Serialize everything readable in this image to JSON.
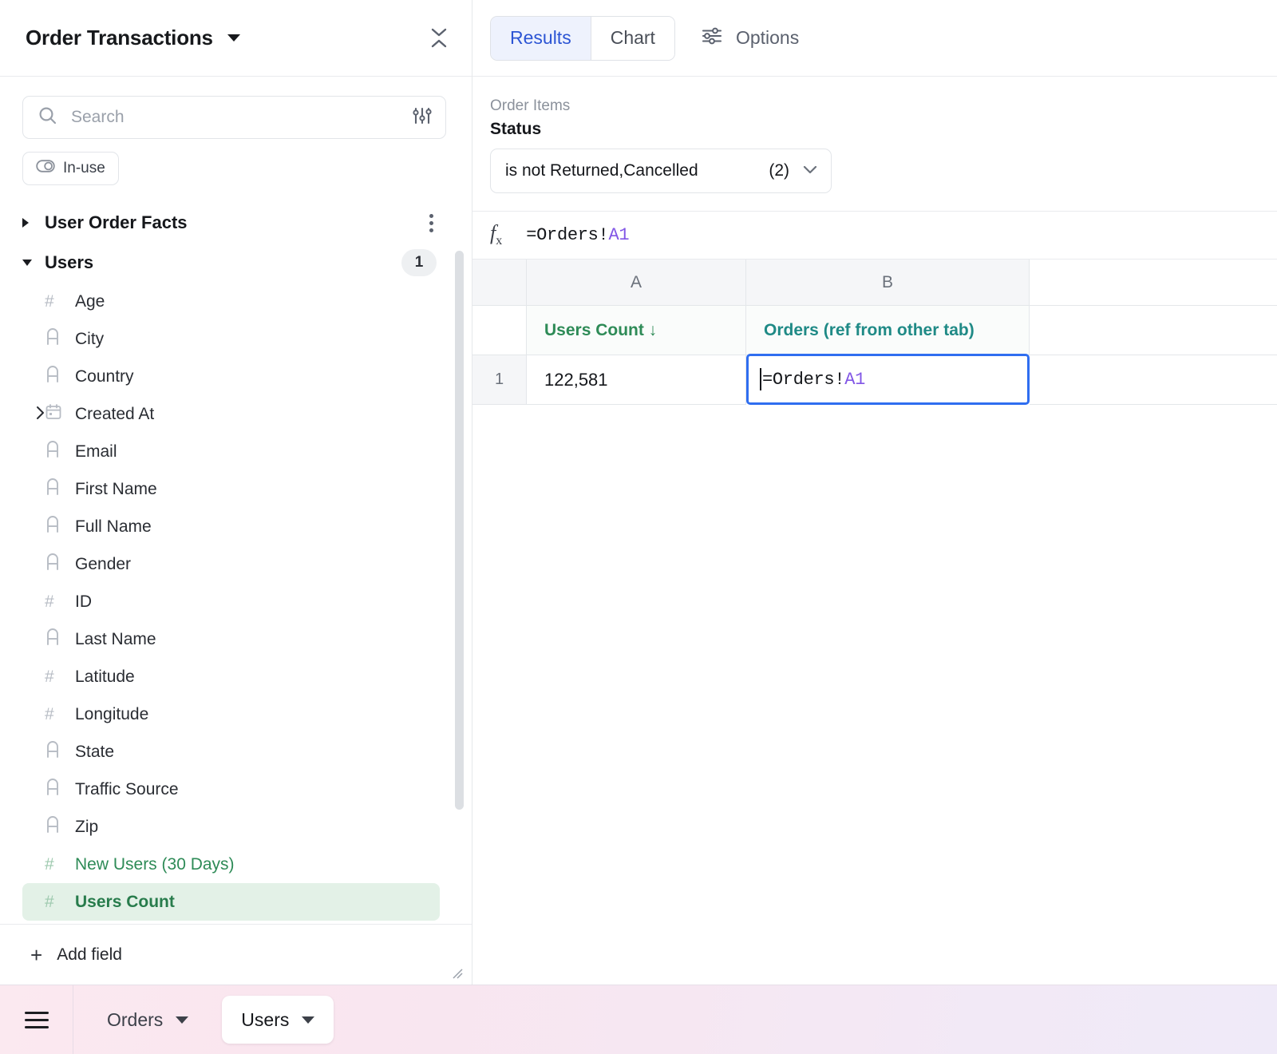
{
  "sidebar": {
    "title": "Order Transactions",
    "title_caret_icon": "caret-down-icon",
    "collapse_icon": "collapse-vertical-icon",
    "search": {
      "placeholder": "Search",
      "value": "",
      "icon": "search-icon",
      "filter_icon": "sliders-icon"
    },
    "chip": {
      "label": "In-use",
      "icon": "toggle-icon"
    },
    "groups": [
      {
        "name": "User Order Facts",
        "expanded": false,
        "menu_icon": "kebab-menu-icon"
      },
      {
        "name": "Users",
        "expanded": true,
        "badge": "1"
      }
    ],
    "fields": [
      {
        "label": "Age",
        "icon": "hash-icon",
        "type": "number",
        "expandable": false,
        "selected": false,
        "measure": false
      },
      {
        "label": "City",
        "icon": "text-icon",
        "type": "text",
        "expandable": false,
        "selected": false,
        "measure": false
      },
      {
        "label": "Country",
        "icon": "text-icon",
        "type": "text",
        "expandable": false,
        "selected": false,
        "measure": false
      },
      {
        "label": "Created At",
        "icon": "calendar-icon",
        "type": "date",
        "expandable": true,
        "selected": false,
        "measure": false
      },
      {
        "label": "Email",
        "icon": "text-icon",
        "type": "text",
        "expandable": false,
        "selected": false,
        "measure": false
      },
      {
        "label": "First Name",
        "icon": "text-icon",
        "type": "text",
        "expandable": false,
        "selected": false,
        "measure": false
      },
      {
        "label": "Full Name",
        "icon": "text-icon",
        "type": "text",
        "expandable": false,
        "selected": false,
        "measure": false
      },
      {
        "label": "Gender",
        "icon": "text-icon",
        "type": "text",
        "expandable": false,
        "selected": false,
        "measure": false
      },
      {
        "label": "ID",
        "icon": "hash-icon",
        "type": "number",
        "expandable": false,
        "selected": false,
        "measure": false
      },
      {
        "label": "Last Name",
        "icon": "text-icon",
        "type": "text",
        "expandable": false,
        "selected": false,
        "measure": false
      },
      {
        "label": "Latitude",
        "icon": "hash-icon",
        "type": "number",
        "expandable": false,
        "selected": false,
        "measure": false
      },
      {
        "label": "Longitude",
        "icon": "hash-icon",
        "type": "number",
        "expandable": false,
        "selected": false,
        "measure": false
      },
      {
        "label": "State",
        "icon": "text-icon",
        "type": "text",
        "expandable": false,
        "selected": false,
        "measure": false
      },
      {
        "label": "Traffic Source",
        "icon": "text-icon",
        "type": "text",
        "expandable": false,
        "selected": false,
        "measure": false
      },
      {
        "label": "Zip",
        "icon": "text-icon",
        "type": "text",
        "expandable": false,
        "selected": false,
        "measure": false
      },
      {
        "label": "New Users (30 Days)",
        "icon": "hash-icon",
        "type": "number",
        "expandable": false,
        "selected": false,
        "measure": true
      },
      {
        "label": "Users Count",
        "icon": "hash-icon",
        "type": "number",
        "expandable": false,
        "selected": true,
        "measure": true
      }
    ],
    "footer": {
      "add_field_label": "Add field",
      "add_icon": "plus-icon",
      "resize_icon": "resize-grip-icon"
    }
  },
  "main": {
    "tabs": [
      {
        "label": "Results",
        "active": true
      },
      {
        "label": "Chart",
        "active": false
      }
    ],
    "options": {
      "label": "Options",
      "icon": "sliders-horizontal-icon"
    },
    "filter": {
      "source": "Order Items",
      "field": "Status",
      "value": "is not Returned,Cancelled",
      "count": "(2)",
      "chevron_icon": "chevron-down-icon"
    },
    "formula_bar": {
      "icon": "fx-icon",
      "prefix": "=Orders!",
      "ref": "A1"
    },
    "grid": {
      "column_letters": [
        "A",
        "B"
      ],
      "column_names": [
        "Users Count ↓",
        "Orders (ref from other tab)"
      ],
      "row_numbers": [
        "1"
      ],
      "rows": [
        {
          "a": "122,581",
          "b_prefix": "=Orders!",
          "b_ref": "A1"
        }
      ],
      "editing_cell": "B1"
    }
  },
  "bottombar": {
    "menu_icon": "hamburger-icon",
    "sheets": [
      {
        "label": "Orders",
        "active": false,
        "caret_icon": "caret-down-icon"
      },
      {
        "label": "Users",
        "active": true,
        "caret_icon": "caret-down-icon"
      }
    ]
  },
  "colors": {
    "accent_blue": "#2c55d4",
    "cell_border_blue": "#2f6ef0",
    "measure_green": "#2e8b57",
    "ref_purple": "#8257e6",
    "teal": "#1f8a86"
  }
}
